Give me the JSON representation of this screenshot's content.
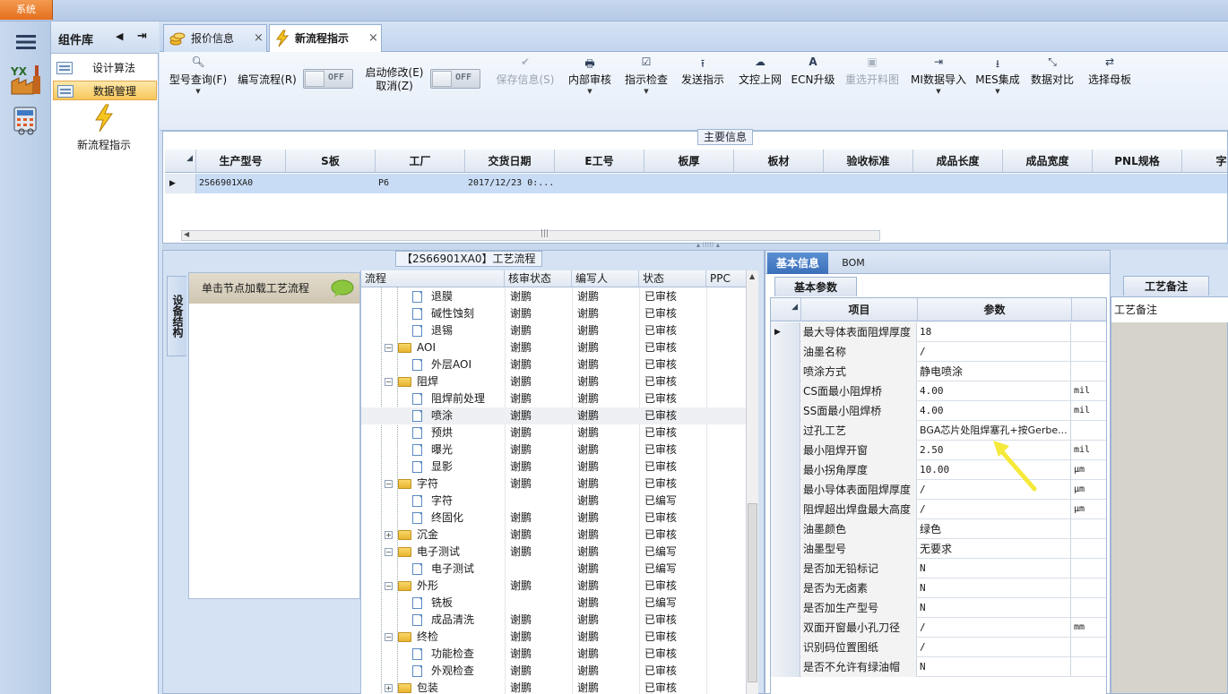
{
  "system_button": "系统",
  "component_library": {
    "title": "组件库",
    "items": [
      {
        "label": "设计算法"
      },
      {
        "label": "数据管理"
      }
    ],
    "launcher_label": "新流程指示"
  },
  "tabs": [
    {
      "label": "报价信息"
    },
    {
      "label": "新流程指示"
    }
  ],
  "toolbar": {
    "model_query": "型号查询(F)",
    "edit_flow": "编写流程(R)",
    "toggle1_state": "OFF",
    "start_modify_line1": "启动修改(E)",
    "start_modify_line2": "取消(Z)",
    "toggle2_state": "OFF",
    "save_info": "保存信息(S)",
    "internal_review": "内部审核",
    "instruction_check": "指示检查",
    "send_instruction": "发送指示",
    "upload_online": "文控上网",
    "ecn_upgrade": "ECN升级",
    "reselect_cut": "重选开料图",
    "mi_import": "MI数据导入",
    "mes_integration": "MES集成",
    "data_compare": "数据对比",
    "select_master": "选择母板"
  },
  "main_info": {
    "caption": "主要信息",
    "columns": [
      "生产型号",
      "S板",
      "工厂",
      "交货日期",
      "E工号",
      "板厚",
      "板材",
      "验收标准",
      "成品长度",
      "成品宽度",
      "PNL规格",
      "字符"
    ],
    "row": {
      "model": "2S66901XA0",
      "factory": "P6",
      "delivery_date": "2017/12/23 0:..."
    }
  },
  "process": {
    "caption": "【2S66901XA0】工艺流程",
    "vertical_tab": "设备结构",
    "node_hint": "单击节点加载工艺流程",
    "columns": [
      "流程",
      "核审状态",
      "编写人",
      "状态",
      "PPC"
    ],
    "rows": [
      {
        "name": "退膜",
        "review": "谢鹏",
        "writer": "谢鹏",
        "status": "已审核"
      },
      {
        "name": "碱性蚀刻",
        "review": "谢鹏",
        "writer": "谢鹏",
        "status": "已审核"
      },
      {
        "name": "退锡",
        "review": "谢鹏",
        "writer": "谢鹏",
        "status": "已审核"
      },
      {
        "name": "AOI",
        "review": "谢鹏",
        "writer": "谢鹏",
        "status": "已审核"
      },
      {
        "name": "外层AOI",
        "review": "谢鹏",
        "writer": "谢鹏",
        "status": "已审核"
      },
      {
        "name": "阻焊",
        "review": "谢鹏",
        "writer": "谢鹏",
        "status": "已审核"
      },
      {
        "name": "阻焊前处理",
        "review": "谢鹏",
        "writer": "谢鹏",
        "status": "已审核"
      },
      {
        "name": "喷涂",
        "review": "谢鹏",
        "writer": "谢鹏",
        "status": "已审核"
      },
      {
        "name": "预烘",
        "review": "谢鹏",
        "writer": "谢鹏",
        "status": "已审核"
      },
      {
        "name": "曝光",
        "review": "谢鹏",
        "writer": "谢鹏",
        "status": "已审核"
      },
      {
        "name": "显影",
        "review": "谢鹏",
        "writer": "谢鹏",
        "status": "已审核"
      },
      {
        "name": "字符",
        "review": "谢鹏",
        "writer": "谢鹏",
        "status": "已审核"
      },
      {
        "name": "字符",
        "review": "",
        "writer": "谢鹏",
        "status": "已编写"
      },
      {
        "name": "终固化",
        "review": "谢鹏",
        "writer": "谢鹏",
        "status": "已审核"
      },
      {
        "name": "沉金",
        "review": "谢鹏",
        "writer": "谢鹏",
        "status": "已审核"
      },
      {
        "name": "电子测试",
        "review": "谢鹏",
        "writer": "谢鹏",
        "status": "已编写"
      },
      {
        "name": "电子测试",
        "review": "",
        "writer": "谢鹏",
        "status": "已编写"
      },
      {
        "name": "外形",
        "review": "谢鹏",
        "writer": "谢鹏",
        "status": "已审核"
      },
      {
        "name": "铣板",
        "review": "",
        "writer": "谢鹏",
        "status": "已编写"
      },
      {
        "name": "成品清洗",
        "review": "谢鹏",
        "writer": "谢鹏",
        "status": "已审核"
      },
      {
        "name": "终检",
        "review": "谢鹏",
        "writer": "谢鹏",
        "status": "已审核"
      },
      {
        "name": "功能检查",
        "review": "谢鹏",
        "writer": "谢鹏",
        "status": "已审核"
      },
      {
        "name": "外观检查",
        "review": "谢鹏",
        "writer": "谢鹏",
        "status": "已审核"
      },
      {
        "name": "包装",
        "review": "谢鹏",
        "writer": "谢鹏",
        "status": "已审核"
      }
    ]
  },
  "basic_info": {
    "tab_active": "基本信息",
    "tab_other": "BOM",
    "param_caption": "基本参数",
    "columns": [
      "项目",
      "参数"
    ],
    "rows": [
      {
        "key": "最大导体表面阻焊厚度",
        "value": "18",
        "unit": ""
      },
      {
        "key": "油墨名称",
        "value": "/",
        "unit": ""
      },
      {
        "key": "喷涂方式",
        "value": "静电喷涂",
        "unit": ""
      },
      {
        "key": "CS面最小阻焊桥",
        "value": "4.00",
        "unit": "mil"
      },
      {
        "key": "SS面最小阻焊桥",
        "value": "4.00",
        "unit": "mil"
      },
      {
        "key": "过孔工艺",
        "value": "BGA芯片处阻焊塞孔+按Gerbe...",
        "unit": ""
      },
      {
        "key": "最小阻焊开窗",
        "value": "2.50",
        "unit": "mil"
      },
      {
        "key": "最小拐角厚度",
        "value": "10.00",
        "unit": "μm"
      },
      {
        "key": "最小导体表面阻焊厚度",
        "value": "/",
        "unit": "μm"
      },
      {
        "key": "阻焊超出焊盘最大高度",
        "value": "/",
        "unit": "μm"
      },
      {
        "key": "油墨颜色",
        "value": "绿色",
        "unit": ""
      },
      {
        "key": "油墨型号",
        "value": "无要求",
        "unit": ""
      },
      {
        "key": "是否加无铅标记",
        "value": "N",
        "unit": ""
      },
      {
        "key": "是否为无卤素",
        "value": "N",
        "unit": ""
      },
      {
        "key": "是否加生产型号",
        "value": "N",
        "unit": ""
      },
      {
        "key": "双面开窗最小孔刀径",
        "value": "/",
        "unit": "mm"
      },
      {
        "key": "识别码位置图纸",
        "value": "/",
        "unit": ""
      },
      {
        "key": "是否不允许有绿油帽",
        "value": "N",
        "unit": ""
      }
    ]
  },
  "remarks": {
    "caption": "工艺备注",
    "column": "工艺备注"
  },
  "colors": {
    "accent_orange": "#e46f1e",
    "selected_tab_blue": "#3b6fb9",
    "highlight_row": "#c9dcf5",
    "annotation_arrow": "#f5e93a"
  }
}
